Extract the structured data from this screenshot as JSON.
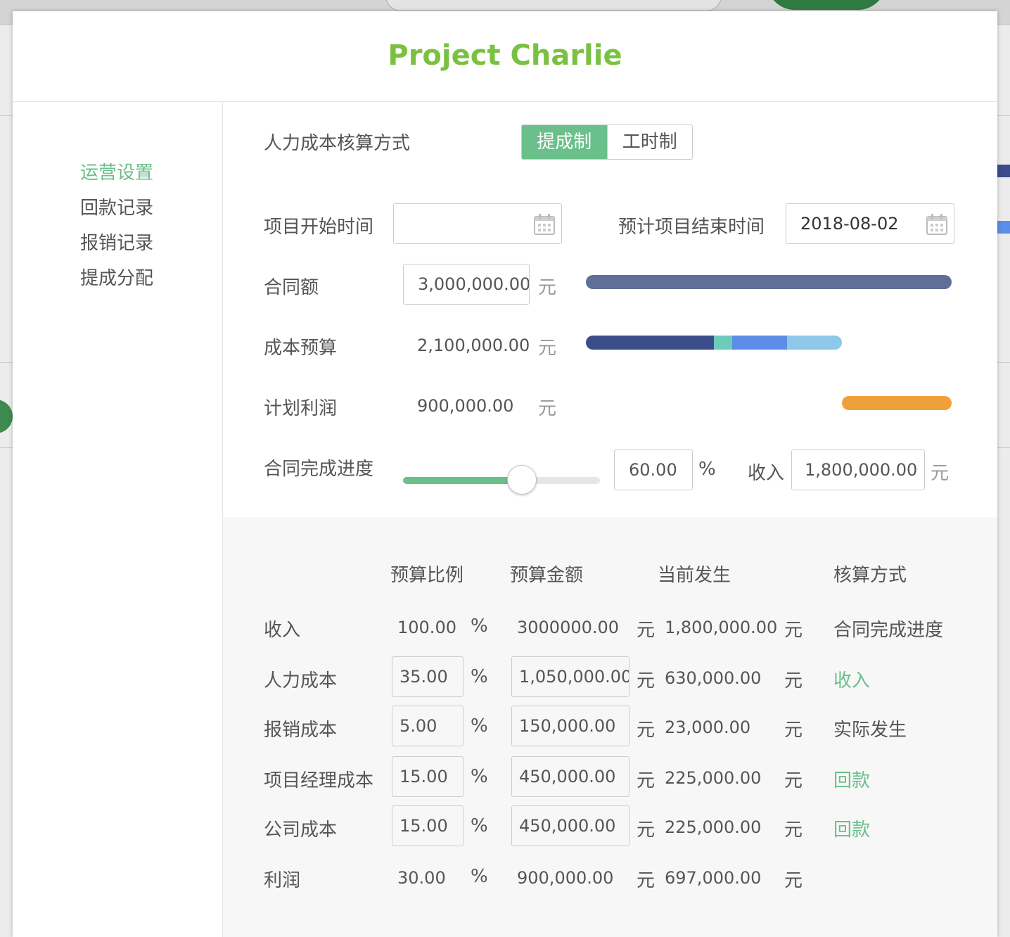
{
  "modal": {
    "title": "Project Charlie"
  },
  "sidebar": {
    "items": [
      {
        "label": "运营设置",
        "active": true
      },
      {
        "label": "回款记录",
        "active": false
      },
      {
        "label": "报销记录",
        "active": false
      },
      {
        "label": "提成分配",
        "active": false
      }
    ]
  },
  "form": {
    "cost_method_label": "人力成本核算方式",
    "cost_method_options": [
      "提成制",
      "工时制"
    ],
    "cost_method_selected": "提成制",
    "start_date_label": "项目开始时间",
    "start_date_value": "",
    "end_date_label": "预计项目结束时间",
    "end_date_value": "2018-08-02",
    "contract_label": "合同额",
    "contract_value": "3,000,000.00",
    "cost_budget_label": "成本预算",
    "cost_budget_value": "2,100,000.00",
    "planned_profit_label": "计划利润",
    "planned_profit_value": "900,000.00",
    "progress_label": "合同完成进度",
    "progress_value": "60.00",
    "progress_percent": 60,
    "percent_sign": "%",
    "income_label": "收入",
    "income_value": "1,800,000.00",
    "unit_yuan": "元"
  },
  "budget_bars": {
    "contract": {
      "color": "#5f6f98"
    },
    "cost_segments": [
      {
        "name": "人力成本",
        "ratio": 35,
        "color": "#3b4d8a"
      },
      {
        "name": "报销成本",
        "ratio": 5,
        "color": "#6ecbb8"
      },
      {
        "name": "项目经理成本",
        "ratio": 15,
        "color": "#5c8ee8"
      },
      {
        "name": "公司成本",
        "ratio": 15,
        "color": "#8ec8e8"
      }
    ],
    "profit": {
      "ratio": 30,
      "color": "#f0a03a"
    }
  },
  "table": {
    "headers": [
      "预算比例",
      "预算金额",
      "当前发生",
      "核算方式"
    ],
    "rows": [
      {
        "name": "收入",
        "ratio": "100.00",
        "amount": "3000000.00",
        "current": "1,800,000.00",
        "method": "合同完成进度",
        "editable": false,
        "method_link": false
      },
      {
        "name": "人力成本",
        "ratio": "35.00",
        "amount": "1,050,000.00",
        "current": "630,000.00",
        "method": "收入",
        "editable": true,
        "method_link": true
      },
      {
        "name": "报销成本",
        "ratio": "5.00",
        "amount": "150,000.00",
        "current": "23,000.00",
        "method": "实际发生",
        "editable": true,
        "method_link": false
      },
      {
        "name": "项目经理成本",
        "ratio": "15.00",
        "amount": "450,000.00",
        "current": "225,000.00",
        "method": "回款",
        "editable": true,
        "method_link": true
      },
      {
        "name": "公司成本",
        "ratio": "15.00",
        "amount": "450,000.00",
        "current": "225,000.00",
        "method": "回款",
        "editable": true,
        "method_link": true
      },
      {
        "name": "利润",
        "ratio": "30.00",
        "amount": "900,000.00",
        "current": "697,000.00",
        "method": "",
        "editable": false,
        "method_link": false
      }
    ]
  }
}
